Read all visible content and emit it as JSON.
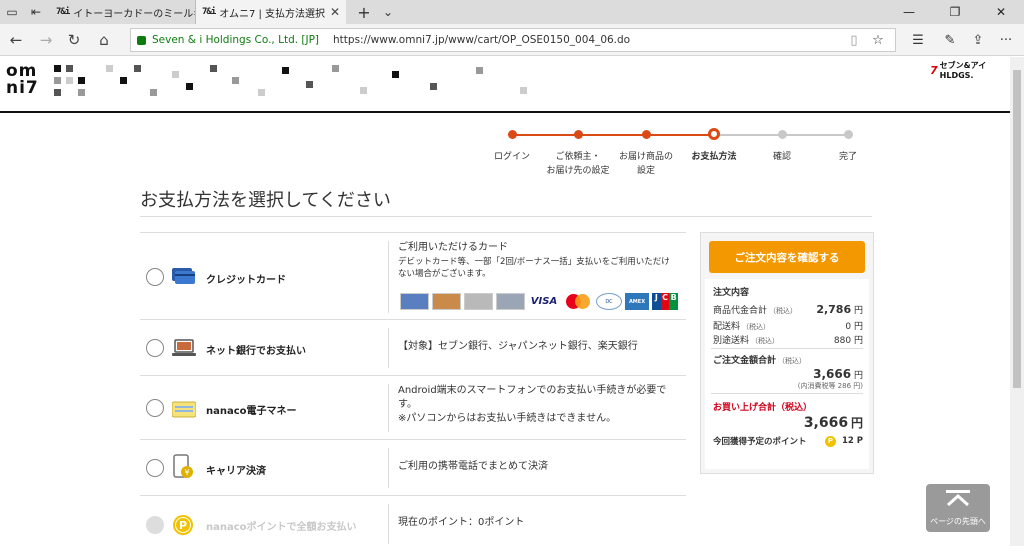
{
  "browser": {
    "tabs": [
      {
        "favicon": "7&i",
        "title": "イトーヨーカドーのミールキット | イ"
      },
      {
        "favicon": "7&i",
        "title": "オムニ7 | 支払方法選択"
      }
    ],
    "site_identity": "Seven & i Holdings Co., Ltd. [JP]",
    "url": "https://www.omni7.jp/www/cart/OP_OSE0150_004_06.do"
  },
  "header": {
    "logo_line1": "om",
    "logo_line2": "ni7",
    "brand_right": "セブン&アイHLDGS."
  },
  "stepper": {
    "steps": [
      {
        "label": "ログイン"
      },
      {
        "label": "ご依頼主・\nお届け先の設定"
      },
      {
        "label": "お届け商品の\n設定"
      },
      {
        "label": "お支払方法"
      },
      {
        "label": "確認"
      },
      {
        "label": "完了"
      }
    ],
    "current_index": 3,
    "colors": {
      "done": "#d94a14",
      "todo": "#c8c8c8"
    }
  },
  "page_title": "お支払方法を選択してください",
  "payment_methods": [
    {
      "label": "クレジットカード",
      "icon": "credit-card-icon",
      "desc_title": "ご利用いただけるカード",
      "desc_note": "デビットカード等、一部「2回/ボーナス一括」支払いをご利用いただけない場合がございます。",
      "cards": [
        "VISA",
        "MasterCard",
        "Diners Club",
        "AMERICAN EXPRESS",
        "JCB"
      ]
    },
    {
      "label": "ネット銀行でお支払い",
      "icon": "laptop-icon",
      "desc": "【対象】セブン銀行、ジャパンネット銀行、楽天銀行"
    },
    {
      "label": "nanaco電子マネー",
      "icon": "nanaco-card-icon",
      "desc": "Android端末のスマートフォンでのお支払い手続きが必要です。\n※パソコンからはお支払い手続きはできません。"
    },
    {
      "label": "キャリア決済",
      "icon": "smartphone-yen-icon",
      "desc": "ご利用の携帯電話でまとめて決済"
    },
    {
      "label": "nanacoポイントで全額お支払い",
      "icon": "point-coin-icon",
      "desc": "現在のポイント：0ポイント",
      "disabled": true
    }
  ],
  "summary": {
    "confirm_button": "ご注文内容を確認する",
    "heading": "注文内容",
    "rows": [
      {
        "label": "商品代金合計",
        "note": "（税込）",
        "value": "2,786",
        "unit": "円"
      },
      {
        "label": "配送料",
        "note": "（税込）",
        "value": "0",
        "unit": "円"
      },
      {
        "label": "別途送料",
        "note": "（税込）",
        "value": "880",
        "unit": "円"
      }
    ],
    "order_total_label": "ご注文金額合計",
    "order_total_note": "（税込）",
    "order_total_value": "3,666",
    "order_total_unit": "円",
    "tax_note": "(内消費税等 286 円)",
    "purchase_total_label": "お買い上げ合計（税込）",
    "purchase_total_value": "3,666",
    "purchase_total_unit": "円",
    "points_label": "今回獲得予定のポイント",
    "points_icon": "P",
    "points_value": "12 P"
  },
  "back_to_top": "ページの先頭へ"
}
